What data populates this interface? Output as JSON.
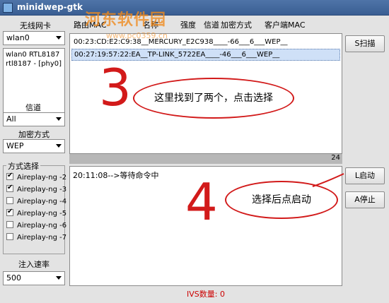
{
  "window": {
    "title": "minidwep-gtk"
  },
  "watermark": {
    "text": "河东软件园",
    "url": "www.pc0359.cn"
  },
  "adapter": {
    "label": "无线网卡",
    "selected": "wlan0",
    "info_lines": [
      "wlan0 RTL8187",
      "rtl8187 - [phy0]"
    ]
  },
  "channel": {
    "label": "信道",
    "selected": "All"
  },
  "encryption": {
    "label": "加密方式",
    "selected": "WEP"
  },
  "modes": {
    "label": "方式选择",
    "items": [
      {
        "label": "Aireplay-ng -2",
        "checked": true
      },
      {
        "label": "Aireplay-ng -3",
        "checked": true
      },
      {
        "label": "Aireplay-ng -4",
        "checked": false
      },
      {
        "label": "Aireplay-ng -5",
        "checked": true
      },
      {
        "label": "Aireplay-ng -6",
        "checked": false
      },
      {
        "label": "Aireplay-ng -7",
        "checked": false
      }
    ]
  },
  "injection_rate": {
    "label": "注入速率",
    "selected": "500"
  },
  "table": {
    "headers": [
      "路由MAC",
      "名称",
      "强度",
      "信道",
      "加密方式",
      "客户端MAC"
    ],
    "rows": [
      "00:23:CD:E2:C9:38__MERCURY_E2C938____-66___6___WEP__",
      "00:27:19:57:22:EA__TP-LINK_5722EA____-46___6___WEP__"
    ],
    "selected_index": 1
  },
  "status": {
    "count": "24"
  },
  "log": {
    "lines": [
      "20:11:08-->等待命令中"
    ]
  },
  "ivs": {
    "text": "IVS数量: 0"
  },
  "buttons": {
    "scan": "S扫描",
    "start": "L启动",
    "stop": "A停止"
  },
  "annotations": {
    "step3_number": "3",
    "step3_text": "这里找到了两个，点击选择",
    "step4_number": "4",
    "step4_text": "选择后点启动"
  },
  "colors": {
    "accent": "#d21a1a",
    "titlebar": "#3a5e93",
    "selection": "#cfe0f7"
  }
}
